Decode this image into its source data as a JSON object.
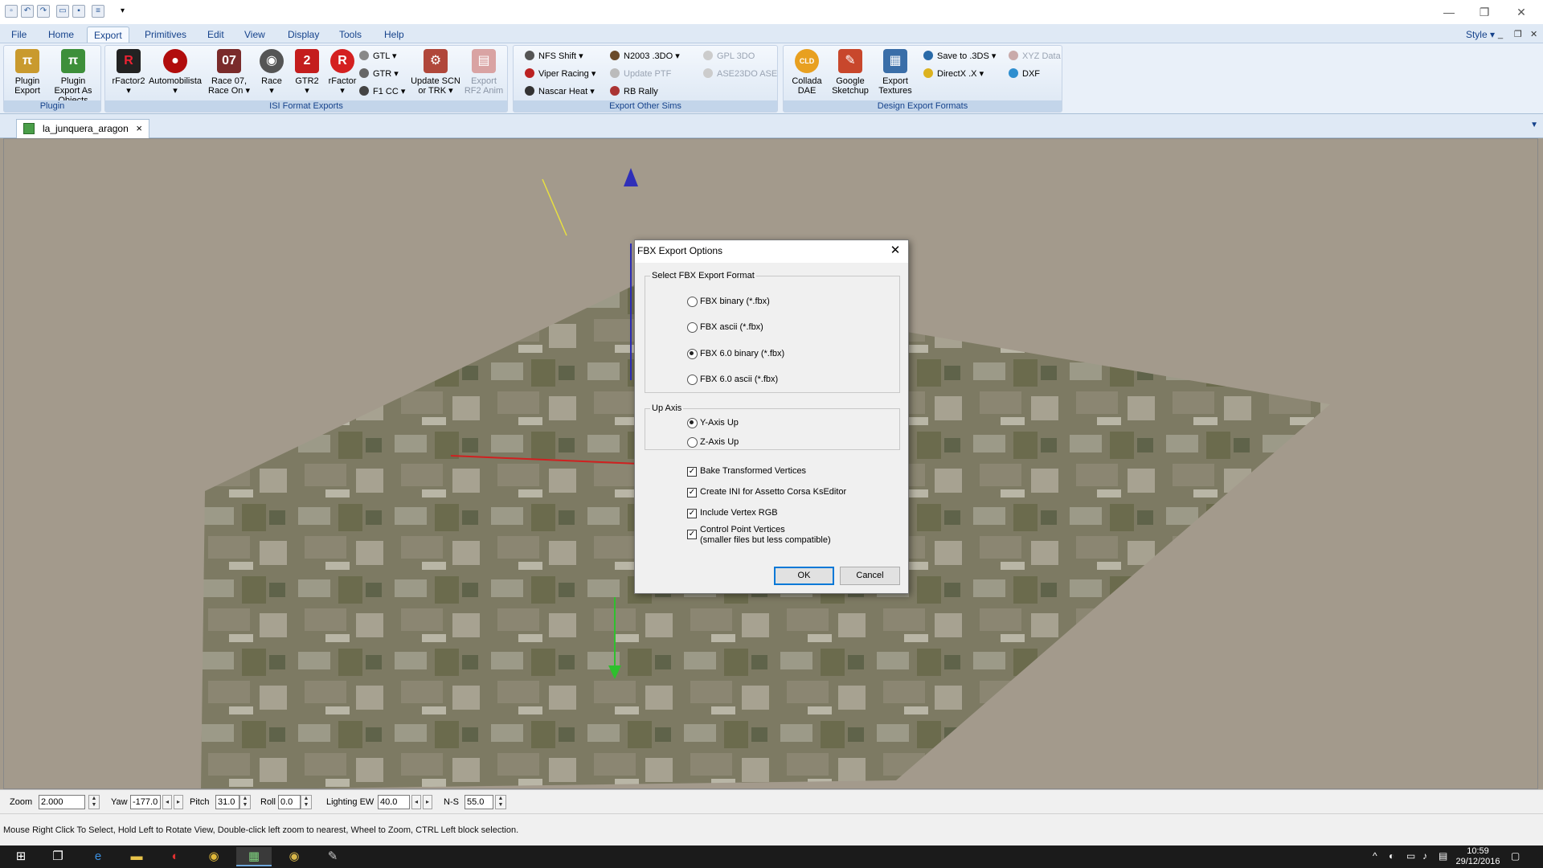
{
  "menubar": {
    "items": [
      "File",
      "Home",
      "Export",
      "Primitives",
      "Edit",
      "View",
      "Display",
      "Tools",
      "Help"
    ],
    "active": "Export",
    "style_label": "Style"
  },
  "ribbon": {
    "groups": {
      "plugin": "Plugin",
      "isi": "ISI Format Exports",
      "other": "Export Other Sims",
      "design": "Design Export Formats"
    },
    "plugin_export": "Plugin Export",
    "plugin_export_objects": "Plugin Export As Objects",
    "rfactor2": "rFactor2",
    "automobilista": "Automobilista",
    "race07": "Race 07, Race On",
    "race": "Race",
    "gtr2": "GTR2",
    "rfactor": "rFactor",
    "gtl": "GTL",
    "gtr": "GTR",
    "f1cc": "F1 CC",
    "update_scn": "Update SCN or TRK",
    "export_rf2_anim": "Export RF2 Anim",
    "nfs_shift": "NFS Shift",
    "viper_racing": "Viper Racing",
    "nascar_heat": "Nascar Heat",
    "n2003": "N2003 .3DO",
    "update_ptf": "Update PTF",
    "rb_rally": "RB Rally",
    "gpl3do": "GPL 3DO",
    "ase23do": "ASE23DO ASE",
    "collada": "Collada DAE",
    "google_sketchup": "Google Sketchup",
    "export_textures": "Export Textures",
    "save3ds": "Save to .3DS",
    "directx": "DirectX .X",
    "xyz": "XYZ Data",
    "dxf": "DXF"
  },
  "doc_tab": {
    "label": "la_junquera_aragon",
    "close": "×"
  },
  "dialog": {
    "title": "FBX Export Options",
    "format_legend": "Select FBX Export Format",
    "formats": [
      "FBX binary (*.fbx)",
      "FBX ascii (*.fbx)",
      "FBX 6.0 binary (*.fbx)",
      "FBX 6.0 ascii (*.fbx)"
    ],
    "format_selected": 2,
    "axis_legend": "Up Axis",
    "axes": [
      "Y-Axis Up",
      "Z-Axis Up"
    ],
    "axis_selected": 0,
    "checks": [
      {
        "label": "Bake Transformed Vertices",
        "checked": true
      },
      {
        "label": "Create INI for Assetto Corsa KsEditor",
        "checked": true
      },
      {
        "label": "Include Vertex RGB",
        "checked": true
      },
      {
        "label": "Control Point Vertices",
        "label2": "(smaller files but less compatible)",
        "checked": true
      }
    ],
    "ok": "OK",
    "cancel": "Cancel"
  },
  "controls": {
    "zoom_label": "Zoom",
    "zoom": "2.000",
    "yaw_label": "Yaw",
    "yaw": "-177.0",
    "pitch_label": "Pitch",
    "pitch": "31.0",
    "roll_label": "Roll",
    "roll": "0.0",
    "lighting_label": "Lighting EW",
    "lighting": "40.0",
    "ns_label": "N-S",
    "ns": "55.0"
  },
  "status": "Mouse Right Click To Select, Hold Left to Rotate View, Double-click left  zoom to nearest, Wheel to Zoom, CTRL Left block selection.",
  "clock": {
    "time": "10:59",
    "date": "29/12/2016"
  },
  "colors": {
    "viewport_bg": "#a39a8c",
    "ribbon_bg": "#e9f0f9",
    "accent": "#15428b"
  }
}
